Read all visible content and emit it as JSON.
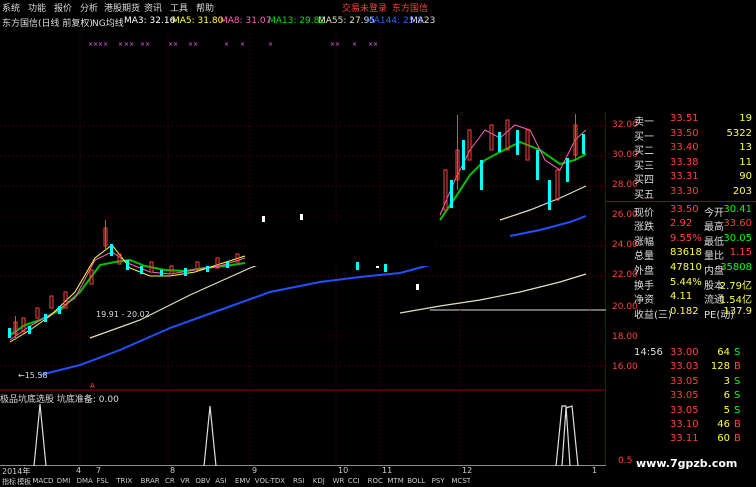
{
  "menu": {
    "items": [
      "系统",
      "功能",
      "报价",
      "分析",
      "港股期货",
      "资讯",
      "工具",
      "帮助"
    ],
    "right_items": [
      "交易未登录",
      "东方国信"
    ]
  },
  "indicator_bar": {
    "title": "东方国信(日线 前复权)",
    "ma_label": "NG均线",
    "ma3": "MA3: 32.16",
    "ma5": "MA5: 31.80",
    "ma8": "MA8: 31.07",
    "ma13": "MA13: 29.82",
    "ma55": "MA55: 27.95",
    "ma144": "MA144: 25.8",
    "ma23": "MA23"
  },
  "chart": {
    "price_levels": [
      "32.00",
      "30.00",
      "28.00",
      "26.00",
      "24.00",
      "22.00",
      "20.00",
      "18.00",
      "16.00"
    ],
    "annotation_low": "←15.58",
    "annotation_mid": "19.91 - 20.02",
    "month_labels": [
      "2014年",
      "4",
      "7",
      "8",
      "9",
      "10",
      "11",
      "12",
      "1"
    ],
    "osc_label": "极品坑底选股  坑底准备: 0.00",
    "osc_level": "0.5"
  },
  "quote_panel": {
    "rows": [
      {
        "l1": "卖一",
        "v1": "33.51",
        "v2": "19"
      },
      {
        "l1": "买一",
        "v1": "33.50",
        "v2": "5322"
      },
      {
        "l1": "买二",
        "v1": "33.40",
        "v2": "13"
      },
      {
        "l1": "买三",
        "v1": "33.38",
        "v2": "11"
      },
      {
        "l1": "买四",
        "v1": "33.31",
        "v2": "90"
      },
      {
        "l1": "买五",
        "v1": "33.30",
        "v2": "203"
      }
    ],
    "stats": [
      {
        "l1": "现价",
        "v1": "33.50",
        "l2": "今开",
        "v2": "30.41"
      },
      {
        "l1": "涨跌",
        "v1": "2.92",
        "l2": "最高",
        "v2": "33.60"
      },
      {
        "l1": "涨幅",
        "v1": "9.55%",
        "l2": "最低",
        "v2": "30.05"
      },
      {
        "l1": "总量",
        "v1": "83618",
        "l2": "量比",
        "v2": "1.15"
      },
      {
        "l1": "外盘",
        "v1": "47810",
        "l2": "内盘",
        "v2": "35808"
      },
      {
        "l1": "换手",
        "v1": "5.44%",
        "l2": "股本",
        "v2": "2.79亿"
      },
      {
        "l1": "净资",
        "v1": "4.11",
        "l2": "流通",
        "v2": "1.54亿"
      },
      {
        "l1": "收益(三)",
        "v1": "0.182",
        "l2": "PE(动)",
        "v2": "137.9"
      }
    ]
  },
  "ticks": [
    {
      "time": "14:56",
      "price": "33.00",
      "vol": "64",
      "side": "S"
    },
    {
      "time": "",
      "price": "33.03",
      "vol": "128",
      "side": "B"
    },
    {
      "time": "",
      "price": "33.05",
      "vol": "3",
      "side": "S"
    },
    {
      "time": "",
      "price": "33.05",
      "vol": "6",
      "side": "S"
    },
    {
      "time": "",
      "price": "33.05",
      "vol": "5",
      "side": "S"
    },
    {
      "time": "",
      "price": "33.10",
      "vol": "46",
      "side": "B"
    },
    {
      "time": "",
      "price": "33.11",
      "vol": "60",
      "side": "B"
    }
  ],
  "bottom_tabs": [
    "指标",
    "模板",
    "MACD",
    "DMI",
    "DMA",
    "FSL",
    "TRIX",
    "BRAR",
    "CR",
    "VR",
    "OBV",
    "ASI",
    "EMV",
    "VOL-TDX",
    "RSI",
    "KDJ",
    "WR",
    "CCI",
    "ROC",
    "MTM",
    "BOLL",
    "PSY",
    "MCST"
  ],
  "watermark": "www.7gpzb.com",
  "colors": {
    "up": "#ff4040",
    "down": "#00ffff",
    "ma_green": "#00c000",
    "ma_blue": "#2050ff",
    "ma_white": "#e0e0c0",
    "ma_pink": "#ff60c0",
    "text_yellow": "#ffff40"
  }
}
